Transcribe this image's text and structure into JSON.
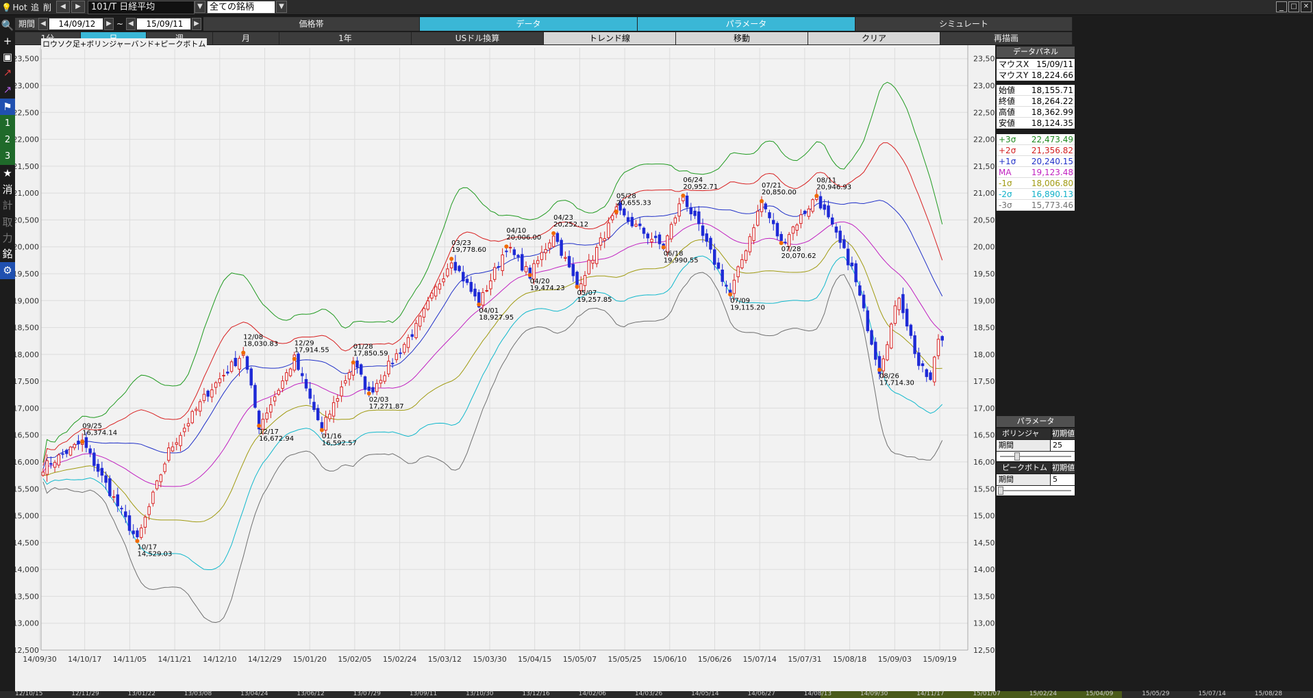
{
  "topbar": {
    "hot": "Hot",
    "add": "追",
    "del": "削",
    "prev": "◀",
    "next": "▶",
    "symbol": "101/T 日経平均",
    "group": "全ての銘柄",
    "dropdown": "▼"
  },
  "period": {
    "label": "期間",
    "from": "14/09/12",
    "tilde": "~",
    "to": "15/09/11"
  },
  "tabs_row1": [
    {
      "label": "価格帯",
      "active": false
    },
    {
      "label": "データ",
      "active": true
    },
    {
      "label": "パラメータ",
      "active": true
    },
    {
      "label": "シミュレート",
      "active": false
    }
  ],
  "tabs_row2": [
    {
      "label": "1分",
      "active": false
    },
    {
      "label": "日",
      "active": true
    },
    {
      "label": "週",
      "active": false
    },
    {
      "label": "月",
      "active": false
    },
    {
      "label": "1年",
      "active": false
    },
    {
      "label": "USドル換算",
      "active": false
    },
    {
      "label": "トレンド線",
      "active": false
    },
    {
      "label": "移動",
      "active": false
    },
    {
      "label": "クリア",
      "active": false
    },
    {
      "label": "再描画",
      "active": false
    }
  ],
  "left_toolbar": [
    {
      "icon": "search-icon",
      "glyph": "🔍"
    },
    {
      "icon": "crosshair-icon",
      "glyph": "+"
    },
    {
      "icon": "camera-icon",
      "glyph": "▣"
    },
    {
      "icon": "line-chart-icon",
      "glyph": "↗"
    },
    {
      "icon": "multi-line-icon",
      "glyph": "↗"
    },
    {
      "icon": "flag-icon",
      "glyph": "⚑"
    },
    {
      "icon": "preset-1-icon",
      "glyph": "1"
    },
    {
      "icon": "preset-2-icon",
      "glyph": "2"
    },
    {
      "icon": "preset-3-icon",
      "glyph": "3"
    },
    {
      "icon": "star-icon",
      "glyph": "★"
    },
    {
      "icon": "erase-icon",
      "glyph": "消"
    },
    {
      "icon": "calc-icon",
      "glyph": "計"
    },
    {
      "icon": "take-icon",
      "glyph": "取"
    },
    {
      "icon": "power-icon",
      "glyph": "力"
    },
    {
      "icon": "brand-icon",
      "glyph": "銘"
    },
    {
      "icon": "gear-icon",
      "glyph": "⚙"
    }
  ],
  "data_panel": {
    "title": "データパネル",
    "rows": [
      {
        "label": "マウスX",
        "value": "15/09/11",
        "color": "#000000"
      },
      {
        "label": "マウスY",
        "value": "18,224.66",
        "color": "#000000"
      },
      {
        "label": "始値",
        "value": "18,155.71",
        "color": "#000000"
      },
      {
        "label": "終値",
        "value": "18,264.22",
        "color": "#000000"
      },
      {
        "label": "高値",
        "value": "18,362.99",
        "color": "#000000"
      },
      {
        "label": "安値",
        "value": "18,124.35",
        "color": "#000000"
      },
      {
        "label": "+3σ",
        "value": "22,473.49",
        "color": "#1f8a1f"
      },
      {
        "label": "+2σ",
        "value": "21,356.82",
        "color": "#d32020"
      },
      {
        "label": "+1σ",
        "value": "20,240.15",
        "color": "#2030c8"
      },
      {
        "label": "MA",
        "value": "19,123.48",
        "color": "#c020c0"
      },
      {
        "label": "-1σ",
        "value": "18,006.80",
        "color": "#a09a10"
      },
      {
        "label": "-2σ",
        "value": "16,890.13",
        "color": "#10b0c8"
      },
      {
        "label": "-3σ",
        "value": "15,773.46",
        "color": "#707070"
      }
    ]
  },
  "param_panel": {
    "title": "パラメータ",
    "bb_label": "ボリンジャー...",
    "bb_reset": "初期値",
    "bb_period_label": "期間",
    "bb_period": "25",
    "pb_label": "ピークボトム",
    "pb_reset": "初期値",
    "pb_period_label": "期間",
    "pb_period": "5"
  },
  "chart_title": "ロウソク足+ボリンジャーバンド+ピークボトム",
  "chart_data": {
    "type": "candlestick",
    "ylim": [
      12500,
      23700
    ],
    "yticks": [
      12500,
      13000,
      13500,
      14000,
      14500,
      15000,
      15500,
      16000,
      16500,
      17000,
      17500,
      18000,
      18500,
      19000,
      19500,
      20000,
      20500,
      21000,
      21500,
      22000,
      22500,
      23000,
      23500
    ],
    "ytick_labels": [
      "12,500",
      "13,000",
      "13,500",
      "14,000",
      "14,500",
      "15,000",
      "15,500",
      "16,000",
      "16,500",
      "17,000",
      "17,500",
      "18,000",
      "18,500",
      "19,000",
      "19,500",
      "20,000",
      "20,500",
      "21,000",
      "21,500",
      "22,000",
      "22,500",
      "23,000",
      "23,500"
    ],
    "xtick_labels": [
      "14/09/30",
      "14/10/17",
      "14/11/05",
      "14/11/21",
      "14/12/10",
      "14/12/29",
      "15/01/20",
      "15/02/05",
      "15/02/24",
      "15/03/12",
      "15/03/30",
      "15/04/15",
      "15/05/07",
      "15/05/25",
      "15/06/10",
      "15/06/26",
      "15/07/14",
      "15/07/31",
      "15/08/18",
      "15/09/03",
      "15/09/19"
    ],
    "bottom_dates": [
      "12/10/15",
      "12/11/29",
      "13/01/22",
      "13/03/08",
      "13/04/24",
      "13/06/12",
      "13/07/29",
      "13/09/11",
      "13/10/30",
      "13/12/16",
      "14/02/06",
      "14/03/26",
      "14/05/14",
      "14/06/27",
      "14/08/13",
      "14/09/30",
      "14/11/17",
      "15/01/07",
      "15/02/24",
      "15/04/09",
      "15/05/29",
      "15/07/14",
      "15/08/28"
    ],
    "anchors": [
      [
        0,
        15900
      ],
      [
        10,
        16374
      ],
      [
        24,
        14529
      ],
      [
        32,
        16200
      ],
      [
        42,
        17300
      ],
      [
        51,
        18031
      ],
      [
        55,
        16673
      ],
      [
        64,
        17915
      ],
      [
        71,
        16593
      ],
      [
        79,
        17851
      ],
      [
        83,
        17272
      ],
      [
        95,
        18500
      ],
      [
        104,
        19777
      ],
      [
        111,
        18928
      ],
      [
        118,
        20006
      ],
      [
        124,
        19474
      ],
      [
        130,
        20252
      ],
      [
        136,
        19258
      ],
      [
        146,
        20655
      ],
      [
        158,
        19991
      ],
      [
        163,
        20953
      ],
      [
        175,
        19115
      ],
      [
        183,
        20850
      ],
      [
        188,
        20071
      ],
      [
        197,
        20947
      ],
      [
        206,
        19600
      ],
      [
        213,
        17714
      ],
      [
        218,
        19100
      ],
      [
        223,
        17800
      ],
      [
        226,
        17500
      ],
      [
        228,
        18300
      ],
      [
        229,
        18264
      ]
    ],
    "annotations": [
      {
        "date": "09/25",
        "value": "16,374.14",
        "i": 10,
        "price": 16374,
        "type": "peak"
      },
      {
        "date": "10/17",
        "value": "14,529.03",
        "i": 24,
        "price": 14529,
        "type": "bottom"
      },
      {
        "date": "12/08",
        "value": "18,030.83",
        "i": 51,
        "price": 18031,
        "type": "peak"
      },
      {
        "date": "12/17",
        "value": "16,672.94",
        "i": 55,
        "price": 16673,
        "type": "bottom"
      },
      {
        "date": "12/29",
        "value": "17,914.55",
        "i": 64,
        "price": 17915,
        "type": "peak"
      },
      {
        "date": "01/16",
        "value": "16,592.57",
        "i": 71,
        "price": 16593,
        "type": "bottom"
      },
      {
        "date": "01/28",
        "value": "17,850.59",
        "i": 79,
        "price": 17851,
        "type": "peak"
      },
      {
        "date": "02/03",
        "value": "17,271.87",
        "i": 83,
        "price": 17272,
        "type": "bottom"
      },
      {
        "date": "03/23",
        "value": "19,778.60",
        "i": 104,
        "price": 19777,
        "type": "peak"
      },
      {
        "date": "04/01",
        "value": "18,927.95",
        "i": 111,
        "price": 18928,
        "type": "bottom"
      },
      {
        "date": "04/10",
        "value": "20,006.00",
        "i": 118,
        "price": 20006,
        "type": "peak"
      },
      {
        "date": "04/20",
        "value": "19,474.23",
        "i": 124,
        "price": 19474,
        "type": "bottom"
      },
      {
        "date": "04/23",
        "value": "20,252.12",
        "i": 130,
        "price": 20252,
        "type": "peak"
      },
      {
        "date": "05/07",
        "value": "19,257.85",
        "i": 136,
        "price": 19258,
        "type": "bottom"
      },
      {
        "date": "05/28",
        "value": "20,655.33",
        "i": 146,
        "price": 20655,
        "type": "peak"
      },
      {
        "date": "06/18",
        "value": "19,990.55",
        "i": 158,
        "price": 19991,
        "type": "bottom"
      },
      {
        "date": "06/24",
        "value": "20,952.71",
        "i": 163,
        "price": 20953,
        "type": "peak"
      },
      {
        "date": "07/09",
        "value": "19,115.20",
        "i": 175,
        "price": 19115,
        "type": "bottom"
      },
      {
        "date": "07/21",
        "value": "20,850.00",
        "i": 183,
        "price": 20850,
        "type": "peak"
      },
      {
        "date": "07/28",
        "value": "20,070.62",
        "i": 188,
        "price": 20071,
        "type": "bottom"
      },
      {
        "date": "08/11",
        "value": "20,946.93",
        "i": 197,
        "price": 20947,
        "type": "peak"
      },
      {
        "date": "08/26",
        "value": "17,714.30",
        "i": 213,
        "price": 17714,
        "type": "bottom"
      }
    ],
    "band_colors": {
      "p3": "#1f9a1f",
      "p2": "#d82020",
      "p1": "#2030c8",
      "ma": "#c020c0",
      "m1": "#a09a10",
      "m2": "#10b8cc",
      "m3": "#707070"
    },
    "up_color": "#d82020",
    "down_color": "#1e2ad6",
    "period": 25,
    "grid": true
  }
}
